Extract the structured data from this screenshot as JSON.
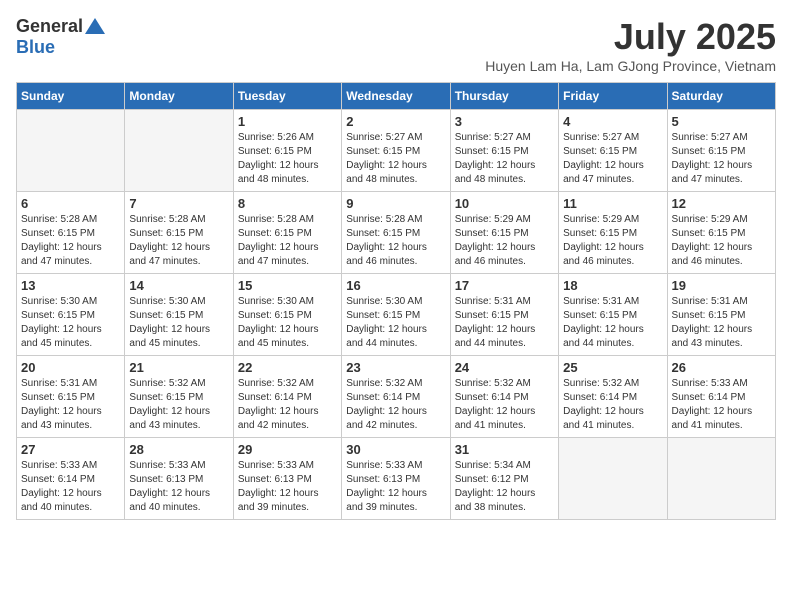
{
  "logo": {
    "general": "General",
    "blue": "Blue"
  },
  "title": {
    "month_year": "July 2025",
    "location": "Huyen Lam Ha, Lam GJong Province, Vietnam"
  },
  "headers": [
    "Sunday",
    "Monday",
    "Tuesday",
    "Wednesday",
    "Thursday",
    "Friday",
    "Saturday"
  ],
  "weeks": [
    [
      {
        "day": "",
        "info": ""
      },
      {
        "day": "",
        "info": ""
      },
      {
        "day": "1",
        "info": "Sunrise: 5:26 AM\nSunset: 6:15 PM\nDaylight: 12 hours and 48 minutes."
      },
      {
        "day": "2",
        "info": "Sunrise: 5:27 AM\nSunset: 6:15 PM\nDaylight: 12 hours and 48 minutes."
      },
      {
        "day": "3",
        "info": "Sunrise: 5:27 AM\nSunset: 6:15 PM\nDaylight: 12 hours and 48 minutes."
      },
      {
        "day": "4",
        "info": "Sunrise: 5:27 AM\nSunset: 6:15 PM\nDaylight: 12 hours and 47 minutes."
      },
      {
        "day": "5",
        "info": "Sunrise: 5:27 AM\nSunset: 6:15 PM\nDaylight: 12 hours and 47 minutes."
      }
    ],
    [
      {
        "day": "6",
        "info": "Sunrise: 5:28 AM\nSunset: 6:15 PM\nDaylight: 12 hours and 47 minutes."
      },
      {
        "day": "7",
        "info": "Sunrise: 5:28 AM\nSunset: 6:15 PM\nDaylight: 12 hours and 47 minutes."
      },
      {
        "day": "8",
        "info": "Sunrise: 5:28 AM\nSunset: 6:15 PM\nDaylight: 12 hours and 47 minutes."
      },
      {
        "day": "9",
        "info": "Sunrise: 5:28 AM\nSunset: 6:15 PM\nDaylight: 12 hours and 46 minutes."
      },
      {
        "day": "10",
        "info": "Sunrise: 5:29 AM\nSunset: 6:15 PM\nDaylight: 12 hours and 46 minutes."
      },
      {
        "day": "11",
        "info": "Sunrise: 5:29 AM\nSunset: 6:15 PM\nDaylight: 12 hours and 46 minutes."
      },
      {
        "day": "12",
        "info": "Sunrise: 5:29 AM\nSunset: 6:15 PM\nDaylight: 12 hours and 46 minutes."
      }
    ],
    [
      {
        "day": "13",
        "info": "Sunrise: 5:30 AM\nSunset: 6:15 PM\nDaylight: 12 hours and 45 minutes."
      },
      {
        "day": "14",
        "info": "Sunrise: 5:30 AM\nSunset: 6:15 PM\nDaylight: 12 hours and 45 minutes."
      },
      {
        "day": "15",
        "info": "Sunrise: 5:30 AM\nSunset: 6:15 PM\nDaylight: 12 hours and 45 minutes."
      },
      {
        "day": "16",
        "info": "Sunrise: 5:30 AM\nSunset: 6:15 PM\nDaylight: 12 hours and 44 minutes."
      },
      {
        "day": "17",
        "info": "Sunrise: 5:31 AM\nSunset: 6:15 PM\nDaylight: 12 hours and 44 minutes."
      },
      {
        "day": "18",
        "info": "Sunrise: 5:31 AM\nSunset: 6:15 PM\nDaylight: 12 hours and 44 minutes."
      },
      {
        "day": "19",
        "info": "Sunrise: 5:31 AM\nSunset: 6:15 PM\nDaylight: 12 hours and 43 minutes."
      }
    ],
    [
      {
        "day": "20",
        "info": "Sunrise: 5:31 AM\nSunset: 6:15 PM\nDaylight: 12 hours and 43 minutes."
      },
      {
        "day": "21",
        "info": "Sunrise: 5:32 AM\nSunset: 6:15 PM\nDaylight: 12 hours and 43 minutes."
      },
      {
        "day": "22",
        "info": "Sunrise: 5:32 AM\nSunset: 6:14 PM\nDaylight: 12 hours and 42 minutes."
      },
      {
        "day": "23",
        "info": "Sunrise: 5:32 AM\nSunset: 6:14 PM\nDaylight: 12 hours and 42 minutes."
      },
      {
        "day": "24",
        "info": "Sunrise: 5:32 AM\nSunset: 6:14 PM\nDaylight: 12 hours and 41 minutes."
      },
      {
        "day": "25",
        "info": "Sunrise: 5:32 AM\nSunset: 6:14 PM\nDaylight: 12 hours and 41 minutes."
      },
      {
        "day": "26",
        "info": "Sunrise: 5:33 AM\nSunset: 6:14 PM\nDaylight: 12 hours and 41 minutes."
      }
    ],
    [
      {
        "day": "27",
        "info": "Sunrise: 5:33 AM\nSunset: 6:14 PM\nDaylight: 12 hours and 40 minutes."
      },
      {
        "day": "28",
        "info": "Sunrise: 5:33 AM\nSunset: 6:13 PM\nDaylight: 12 hours and 40 minutes."
      },
      {
        "day": "29",
        "info": "Sunrise: 5:33 AM\nSunset: 6:13 PM\nDaylight: 12 hours and 39 minutes."
      },
      {
        "day": "30",
        "info": "Sunrise: 5:33 AM\nSunset: 6:13 PM\nDaylight: 12 hours and 39 minutes."
      },
      {
        "day": "31",
        "info": "Sunrise: 5:34 AM\nSunset: 6:12 PM\nDaylight: 12 hours and 38 minutes."
      },
      {
        "day": "",
        "info": ""
      },
      {
        "day": "",
        "info": ""
      }
    ]
  ]
}
